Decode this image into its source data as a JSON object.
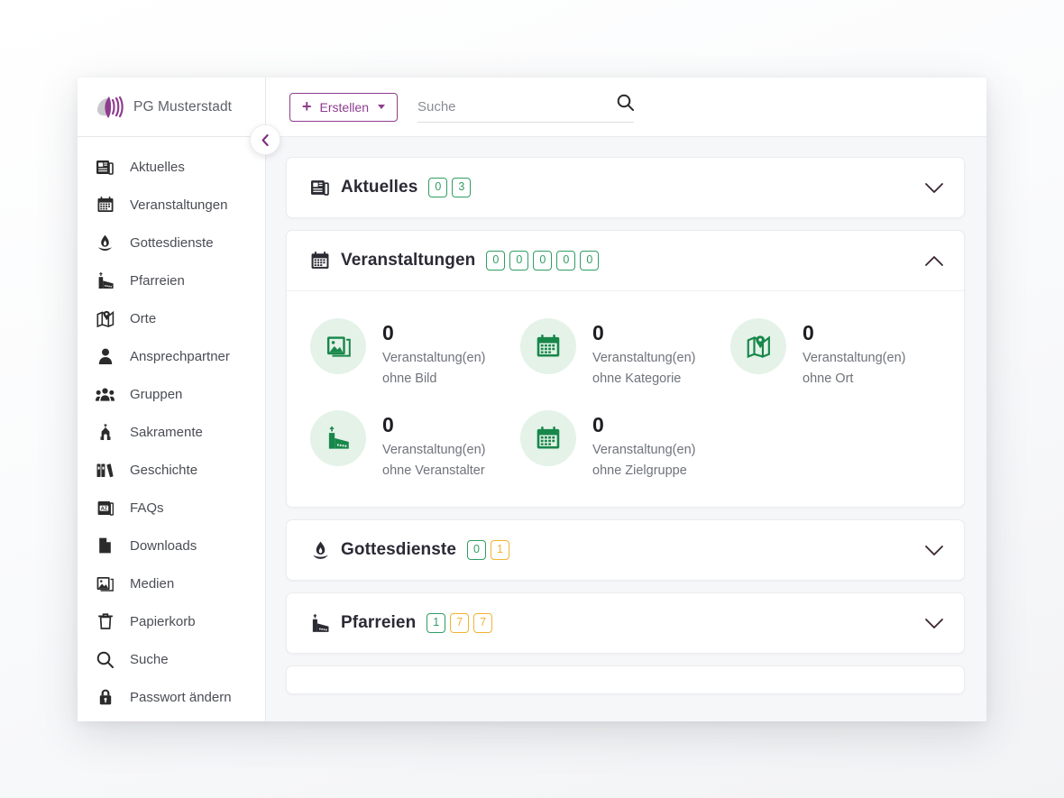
{
  "brand": {
    "name": "PG Musterstadt",
    "logo_icon": "sound-wave-logo"
  },
  "sidebar": {
    "collapse_toggle_icon": "chevron-left-icon",
    "items": [
      {
        "label": "Aktuelles",
        "icon": "newspaper-icon"
      },
      {
        "label": "Veranstaltungen",
        "icon": "calendar-icon"
      },
      {
        "label": "Gottesdienste",
        "icon": "flame-icon"
      },
      {
        "label": "Pfarreien",
        "icon": "church-icon"
      },
      {
        "label": "Orte",
        "icon": "map-pin-icon"
      },
      {
        "label": "Ansprechpartner",
        "icon": "person-icon"
      },
      {
        "label": "Gruppen",
        "icon": "people-group-icon"
      },
      {
        "label": "Sakramente",
        "icon": "chapel-icon"
      },
      {
        "label": "Geschichte",
        "icon": "books-icon"
      },
      {
        "label": "FAQs",
        "icon": "az-book-icon"
      },
      {
        "label": "Downloads",
        "icon": "file-icon"
      },
      {
        "label": "Medien",
        "icon": "image-icon"
      },
      {
        "label": "Papierkorb",
        "icon": "trash-icon"
      },
      {
        "label": "Suche",
        "icon": "search-icon"
      },
      {
        "label": "Passwort ändern",
        "icon": "lock-icon"
      }
    ]
  },
  "topbar": {
    "create_label": "Erstellen",
    "create_plus_icon": "plus-icon",
    "create_caret_icon": "caret-down-icon",
    "search_placeholder": "Suche",
    "search_value": "",
    "search_icon": "search-icon"
  },
  "colors": {
    "brand_purple": "#8e3d8e",
    "badge_green": "#2f9e63",
    "badge_amber": "#f1b434",
    "stat_icon_green": "#18874a",
    "stat_circle_bg": "#e4f2e8",
    "content_bg": "#f6f7f9"
  },
  "sections": [
    {
      "title": "Aktuelles",
      "icon": "newspaper-icon",
      "expanded": false,
      "chevron_icon": "chevron-down-icon",
      "badges": [
        {
          "value": "0",
          "tone": "green"
        },
        {
          "value": "3",
          "tone": "green"
        }
      ]
    },
    {
      "title": "Veranstaltungen",
      "icon": "calendar-icon",
      "expanded": true,
      "chevron_icon": "chevron-up-icon",
      "badges": [
        {
          "value": "0",
          "tone": "green"
        },
        {
          "value": "0",
          "tone": "green"
        },
        {
          "value": "0",
          "tone": "green"
        },
        {
          "value": "0",
          "tone": "green"
        },
        {
          "value": "0",
          "tone": "green"
        }
      ],
      "stats": [
        {
          "value": "0",
          "label": "Veranstaltung(en) ohne Bild",
          "icon": "image-icon"
        },
        {
          "value": "0",
          "label": "Veranstaltung(en) ohne Kategorie",
          "icon": "calendar-icon"
        },
        {
          "value": "0",
          "label": "Veranstaltung(en) ohne Ort",
          "icon": "map-pin-icon"
        },
        {
          "value": "0",
          "label": "Veranstaltung(en) ohne Veranstalter",
          "icon": "church-icon"
        },
        {
          "value": "0",
          "label": "Veranstaltung(en) ohne Zielgruppe",
          "icon": "calendar-icon"
        }
      ]
    },
    {
      "title": "Gottesdienste",
      "icon": "flame-icon",
      "expanded": false,
      "chevron_icon": "chevron-down-icon",
      "badges": [
        {
          "value": "0",
          "tone": "green"
        },
        {
          "value": "1",
          "tone": "amber"
        }
      ]
    },
    {
      "title": "Pfarreien",
      "icon": "church-icon",
      "expanded": false,
      "chevron_icon": "chevron-down-icon",
      "badges": [
        {
          "value": "1",
          "tone": "green"
        },
        {
          "value": "7",
          "tone": "amber"
        },
        {
          "value": "7",
          "tone": "amber"
        }
      ]
    }
  ]
}
